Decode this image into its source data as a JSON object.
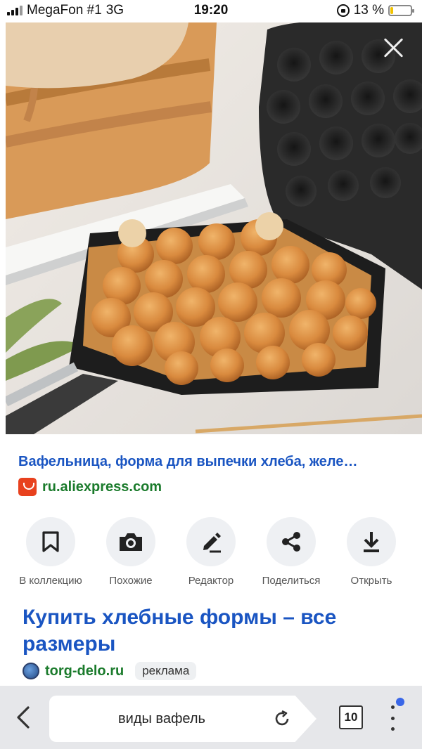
{
  "status_bar": {
    "carrier": "MegaFon #1",
    "network": "3G",
    "time": "19:20",
    "battery_percent_text": "13 %",
    "battery_level": 0.13
  },
  "image": {
    "alt": "",
    "close_icon": "close-icon"
  },
  "result": {
    "title": "Вафельница, форма для выпечки хлеба, желе…",
    "source": "ru.aliexpress.com",
    "source_icon": "aliexpress-logo-icon"
  },
  "actions": [
    {
      "label": "В коллекцию",
      "icon": "bookmark-icon"
    },
    {
      "label": "Похожие",
      "icon": "camera-search-icon"
    },
    {
      "label": "Редактор",
      "icon": "pencil-icon"
    },
    {
      "label": "Поделиться",
      "icon": "share-icon"
    },
    {
      "label": "Открыть",
      "icon": "download-icon"
    }
  ],
  "ad": {
    "title": "Купить хлебные формы – все размеры",
    "domain": "torg-delo.ru",
    "badge": "реклама"
  },
  "bottom_bar": {
    "url_text": "виды вафель",
    "tabs_count": "10"
  },
  "colors": {
    "link_blue": "#1a55c2",
    "source_green": "#1b7b2c",
    "battery_yellow": "#f2c300",
    "notification_blue": "#3a67e8"
  }
}
